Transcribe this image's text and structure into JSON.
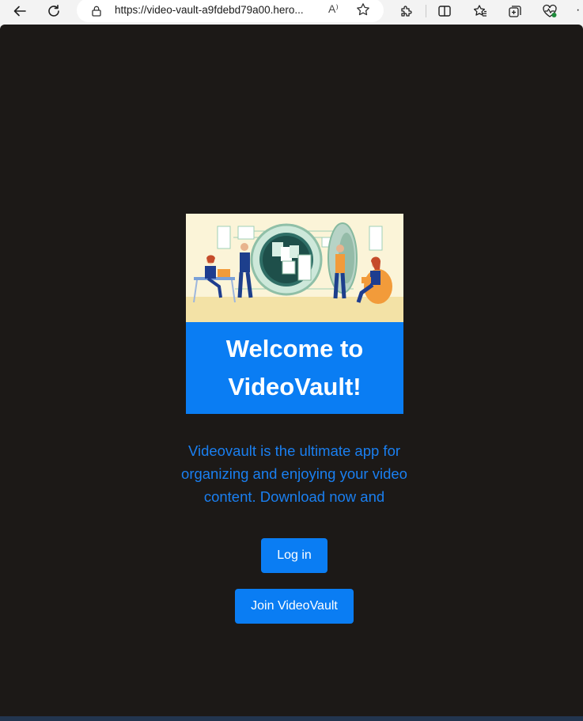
{
  "browser": {
    "url": "https://video-vault-a9fdebd79a00.hero...",
    "read_aloud_label": "A⁾"
  },
  "page": {
    "banner_title": "Welcome to VideoVault!",
    "description": "Videovault is the ultimate app for organizing and enjoying your video content. Download now and",
    "login_label": "Log in",
    "join_label": "Join VideoVault"
  },
  "colors": {
    "page_bg": "#1c1917",
    "brand_blue": "#0a7df3",
    "desc_text": "#1a7ff0"
  },
  "icons": {
    "back": "back-arrow-icon",
    "refresh": "refresh-icon",
    "lock": "lock-icon",
    "favorite": "star-icon",
    "extensions": "puzzle-icon",
    "split": "split-screen-icon",
    "favorites": "favorites-icon",
    "collections": "collections-icon",
    "performance": "heart-pulse-icon",
    "more": "more-icon"
  }
}
